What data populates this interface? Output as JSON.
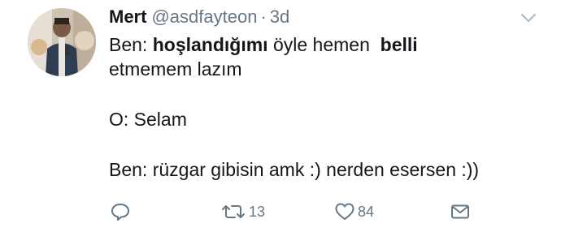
{
  "tweet": {
    "author_name": "Mert",
    "author_handle": "@asdfayteon",
    "separator": "·",
    "timestamp": "3d",
    "text": {
      "line1_prefix": "Ben: ",
      "line1_bold1": "hoşlandığımı",
      "line1_mid": " öyle hemen  ",
      "line1_bold2": "belli",
      "line2": "etmemem lazım",
      "line3": "O: Selam",
      "line4": "Ben: rüzgar gibisin amk :) nerden esersen :))"
    },
    "actions": {
      "reply_icon": "reply-icon",
      "retweet_icon": "retweet-icon",
      "retweet_count": "13",
      "like_icon": "heart-icon",
      "like_count": "84",
      "message_icon": "envelope-icon"
    },
    "colors": {
      "text": "#14171a",
      "secondary": "#657786"
    }
  }
}
